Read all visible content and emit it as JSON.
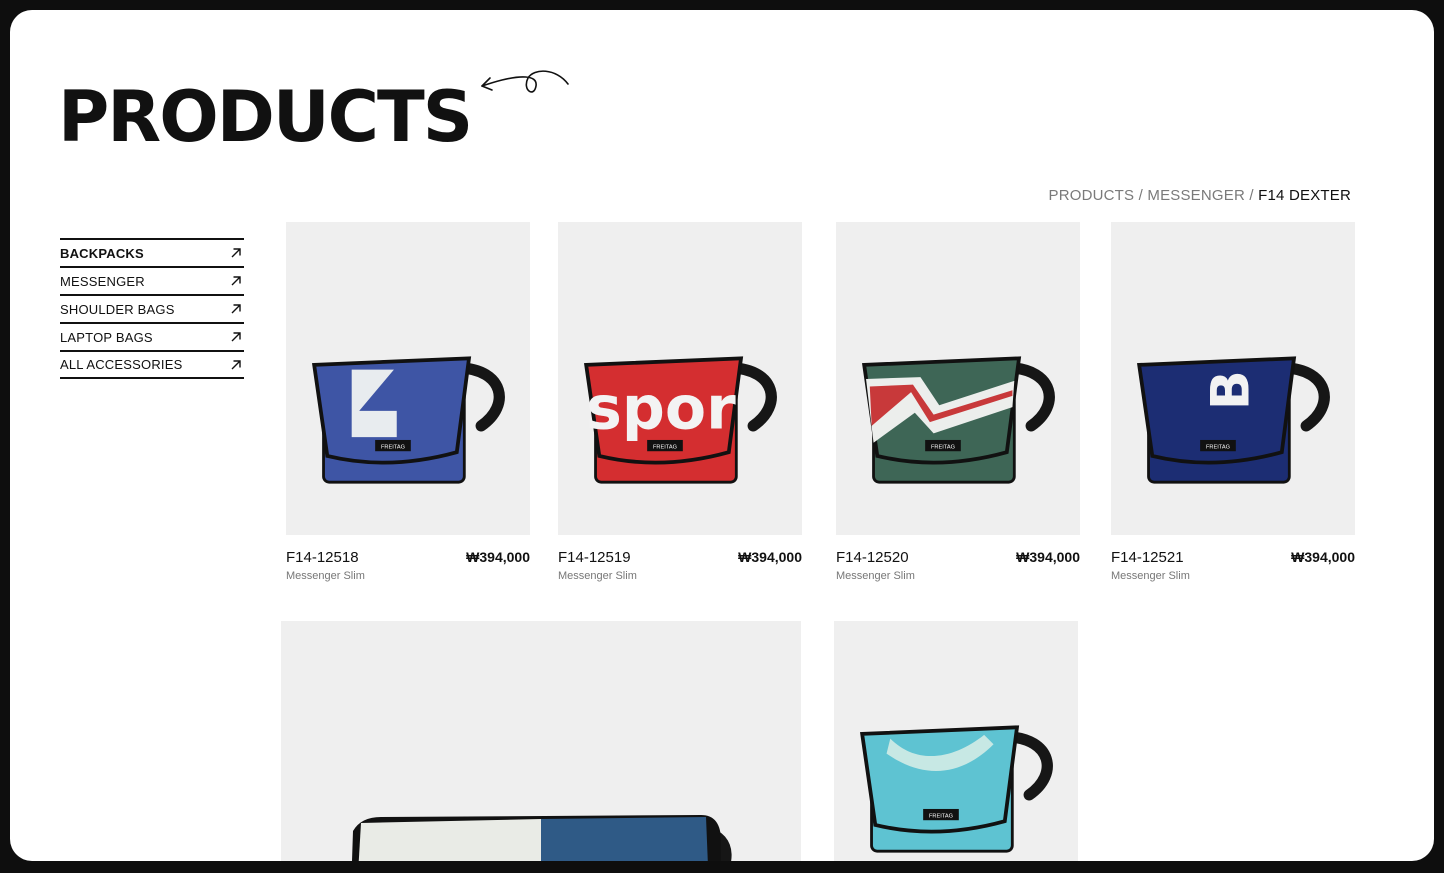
{
  "page": {
    "title": "PRODUCTS"
  },
  "breadcrumb": {
    "items": [
      "PRODUCTS",
      "MESSENGER"
    ],
    "separator": " / ",
    "current": "F14 DEXTER"
  },
  "sidebar": {
    "items": [
      {
        "label": "BACKPACKS",
        "icon": "arrow-up-right-icon"
      },
      {
        "label": "MESSENGER",
        "icon": "arrow-up-right-icon"
      },
      {
        "label": "SHOULDER BAGS",
        "icon": "arrow-up-right-icon"
      },
      {
        "label": "LAPTOP BAGS",
        "icon": "arrow-up-right-icon"
      },
      {
        "label": "ALL ACCESSORIES",
        "icon": "arrow-up-right-icon"
      }
    ]
  },
  "products": [
    {
      "code": "F14-12518",
      "price": "₩394,000",
      "subtitle": "Messenger Slim",
      "color": "#3e55a5",
      "label_text": "FREITAG"
    },
    {
      "code": "F14-12519",
      "price": "₩394,000",
      "subtitle": "Messenger Slim",
      "color": "#d42e30",
      "print": "spor",
      "label_text": "FREITAG"
    },
    {
      "code": "F14-12520",
      "price": "₩394,000",
      "subtitle": "Messenger Slim",
      "color": "#3e6656",
      "label_text": "FREITAG"
    },
    {
      "code": "F14-12521",
      "price": "₩394,000",
      "subtitle": "Messenger Slim",
      "color": "#1c2d73",
      "print": "B",
      "label_text": "FREITAG"
    },
    {
      "color": "#e9ebe6"
    },
    {
      "color": "#5ec3d2",
      "label_text": "FREITAG"
    }
  ],
  "colors": {
    "background": "#ffffff",
    "frame": "#0e0e0e",
    "image_bg": "#efefef",
    "text": "#111111",
    "muted": "#7a7a7a"
  }
}
